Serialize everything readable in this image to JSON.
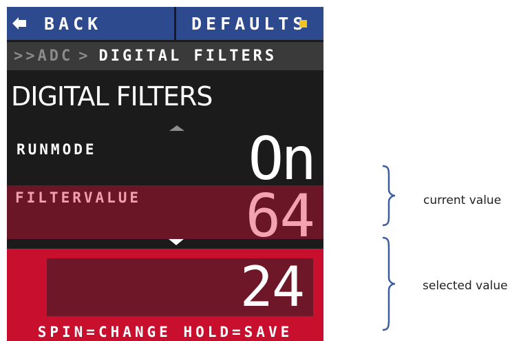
{
  "topbar": {
    "back_label": "BACK",
    "defaults_label": "DEFAULTS"
  },
  "breadcrumb": {
    "prefix": ">> ",
    "parent": "ADC",
    "separator": ">",
    "current": "DIGITAL FILTERS"
  },
  "page": {
    "title": "DIGITAL FILTERS"
  },
  "params": [
    {
      "label": "RUNMODE",
      "value": "On"
    },
    {
      "label": "FILTERVALUE",
      "value": "64"
    }
  ],
  "editor": {
    "selected_value": "24",
    "hint": "SPIN=CHANGE HOLD=SAVE"
  },
  "annotations": {
    "current": "current value",
    "selected": "selected value"
  },
  "icons": {
    "back": "left-arrow-icon",
    "defaults_indicator": "square-indicator-icon",
    "scroll_up": "triangle-up-icon",
    "scroll_down": "triangle-down-icon"
  },
  "colors": {
    "button_blue": "#2e4a8f",
    "accent_red": "#c8102e",
    "dark_red": "#6b1627",
    "indicator_yellow": "#f3c324",
    "background": "#1b1b1b"
  }
}
